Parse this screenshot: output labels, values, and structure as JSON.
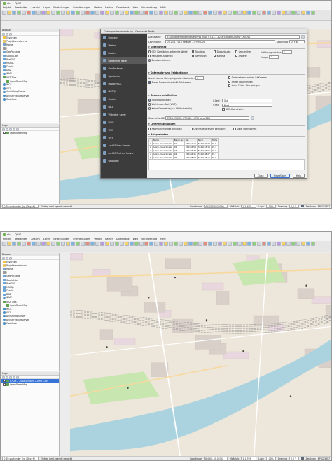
{
  "app": {
    "title": "QGIS",
    "title_prefix": "nb — "
  },
  "menu": [
    "Projekt",
    "Bearbeiten",
    "Ansicht",
    "Layer",
    "Einstellungen",
    "Erweiterungen",
    "Vektor",
    "Raster",
    "Datenbank",
    "Web",
    "Verarbeitung",
    "Hilfe"
  ],
  "browser": {
    "title": "Browser",
    "items": [
      {
        "label": "Favoriten",
        "icon": "star-icon"
      },
      {
        "label": "Projektverzeichnis",
        "icon": "folder-icon"
      },
      {
        "label": "Home",
        "icon": "home-icon"
      },
      {
        "label": "/",
        "icon": "disk-icon"
      },
      {
        "label": "GeoPackage",
        "icon": "database-icon"
      },
      {
        "label": "SpatiaLite",
        "icon": "database-icon"
      },
      {
        "label": "PostGIS",
        "icon": "database-icon"
      },
      {
        "label": "MSSQL",
        "icon": "database-icon"
      },
      {
        "label": "Oracle",
        "icon": "database-icon"
      },
      {
        "label": "DB2",
        "icon": "database-icon"
      },
      {
        "label": "WMS",
        "icon": "globe-icon"
      },
      {
        "label": "XYZ Tiles",
        "icon": "grid-icon"
      },
      {
        "label": "OpenStreetMap",
        "icon": "grid-icon",
        "sub": true
      },
      {
        "label": "WCS",
        "icon": "globe-icon"
      },
      {
        "label": "WFS",
        "icon": "globe-icon"
      },
      {
        "label": "ArcGisMapServer",
        "icon": "globe-icon"
      },
      {
        "label": "ArcGisFeatureServer",
        "icon": "globe-icon"
      },
      {
        "label": "GeoNode",
        "icon": "globe-icon"
      }
    ]
  },
  "layers": {
    "title": "Layer",
    "shot1_items": [
      {
        "label": "OpenStreetMap",
        "selected": false
      }
    ],
    "shot2_items": [
      {
        "label": "07.23.1 2018 Straßen 2.0 für CSV",
        "selected": true
      },
      {
        "label": "OpenStreetMap",
        "selected": false
      }
    ]
  },
  "status": {
    "search_placeholder": "Q  Zu suchender Typ (Strg+K)",
    "legend_hint": "Eintrag der Legende gedockt",
    "coordinate_label": "Koordinate",
    "coordinate_value_1": "461055,5534100",
    "coordinate_value_2": "8.4301,50.0034",
    "scale_label": "Maßstab",
    "scale_value_1": "1:1.950",
    "scale_value_2": "1:1.759",
    "magnifier_label": "Lupe",
    "magnifier_value": "100%",
    "rotation_label": "Drehung",
    "rotation_value": "0,0 °",
    "render_label": "Zeichnen",
    "crs": "EPSG:3857"
  },
  "dialog": {
    "title": "Datenquellenverwaltung | Getrennte Texte",
    "nav": [
      {
        "label": "Browser",
        "selected": false
      },
      {
        "label": "Vektor",
        "selected": false
      },
      {
        "label": "Raster",
        "selected": false
      },
      {
        "label": "Getrennte Texte",
        "selected": true
      },
      {
        "label": "GeoPackage",
        "selected": false
      },
      {
        "label": "SpatiaLite",
        "selected": false
      },
      {
        "label": "PostgreSQL",
        "selected": false
      },
      {
        "label": "MSSQL",
        "selected": false
      },
      {
        "label": "Oracle",
        "selected": false
      },
      {
        "label": "DB2",
        "selected": false
      },
      {
        "label": "Virtueller Layer",
        "selected": false
      },
      {
        "label": "WMS",
        "selected": false
      },
      {
        "label": "WCS",
        "selected": false
      },
      {
        "label": "WFS",
        "selected": false
      },
      {
        "label": "ArcGIS Map Server",
        "selected": false
      },
      {
        "label": "ArcGIS Feature Server",
        "selected": false
      },
      {
        "label": "GeoNode",
        "selected": false
      }
    ],
    "file_label": "Dateiname",
    "file_value": "E:/Uploads/Straßenverzeichnis 2018 07.23.1 2018 Straßen 2.0 für CSV.csv",
    "layer_label": "Layername",
    "layer_value": "07.23.1 2018 Straßen 2.0 für CSV",
    "encoding_label": "Kodierung",
    "encoding_value": "UTF-8",
    "file_format_heading": "Dateiformat",
    "formats": [
      {
        "label": "CSV (Semikolon-getrennte Werte)",
        "on": false
      },
      {
        "label": "Regulärer Ausdruck",
        "on": false
      },
      {
        "label": "Benutzerdefiniert",
        "on": true
      }
    ],
    "delimiters": [
      {
        "label": "Tabulator",
        "on": false
      },
      {
        "label": "Semikolon",
        "on": true
      },
      {
        "label": "Leerzeichen",
        "on": false
      },
      {
        "label": "Doppelpunkt",
        "on": false
      },
      {
        "label": "Komma",
        "on": false
      },
      {
        "label": "Andere",
        "on": false
      }
    ],
    "quote_label": "Anführungszeichen",
    "quote_value": "\"",
    "escape_label": "Escape",
    "escape_value": "\"",
    "records_heading": "Datensatz- und Feldoptionen",
    "header_skip_label": "Anzahl der zu überspringenden Kopfzeilen",
    "header_skip_value": "0",
    "record_options": [
      {
        "label": "Erster Datensatz enthält Feldnamen",
        "on": true
      },
      {
        "label": "Dezimaltrennzeichen ist Komma",
        "on": false
      },
      {
        "label": "Felder abschneiden",
        "on": false
      },
      {
        "label": "Leere Felder überspringen",
        "on": false
      }
    ],
    "geometry_heading": "Geometriedefinition",
    "geometry_options": [
      {
        "label": "Punktkoordinaten",
        "on": true
      },
      {
        "label": "Well-known-Text (WKT)",
        "on": false
      },
      {
        "label": "Keine Geometrie (nur Attributtabelle)",
        "on": false
      }
    ],
    "x_label": "X-Feld",
    "x_value": "Ost",
    "y_label": "Y-Feld",
    "y_value": "Nord",
    "dms_label": "DMS-Koordinaten",
    "crs_label": "Geometrie-KBS",
    "crs_value": "EPSG:25832 - ETRS89 / UTM zone 32N",
    "layer_settings_heading": "Layereinstellungen",
    "layer_settings": [
      {
        "label": "Räumlichen Index benutzen",
        "on": false
      },
      {
        "label": "Unterindexgrenzen benutzen",
        "on": false
      },
      {
        "label": "Datei überwachen",
        "on": false
      }
    ],
    "sample_heading": "Beispieldaten",
    "sample_columns": [
      "",
      "Name",
      "Baum-Nr.",
      "Ost",
      "Nord",
      "Höhe"
    ],
    "sample_rows": [
      [
        "1",
        "Adam-Riese-Straße",
        "01",
        "559151,16",
        "5541179,22",
        "97,5"
      ],
      [
        "2",
        "Adam-Riese-Straße",
        "02",
        "559156,54",
        "5541163,14",
        "97,4"
      ],
      [
        "3",
        "Adam-Riese-Straße",
        "03",
        "559136,33",
        "5541176,05",
        "97,6"
      ],
      [
        "4",
        "Adam-Riese-Straße",
        "04",
        "559134,41",
        "5541188,27",
        "97,7"
      ],
      [
        "5",
        "Adam-Riese-Straße",
        "05",
        "559128,62",
        "5541197,16",
        "97,8"
      ]
    ],
    "close_label": "Close",
    "add_label": "Hinzufügen",
    "help_label": "Help"
  },
  "colors": {
    "accent": "#3874d8",
    "nav_bg": "#3c3c3c",
    "map_land": "#ede6da",
    "river": "#aad3df",
    "rail": "#9b9b9b",
    "road_major": "#f7d99e",
    "industrial": "#e9d7df",
    "green": "#c8e6b0",
    "point": "#444444"
  }
}
